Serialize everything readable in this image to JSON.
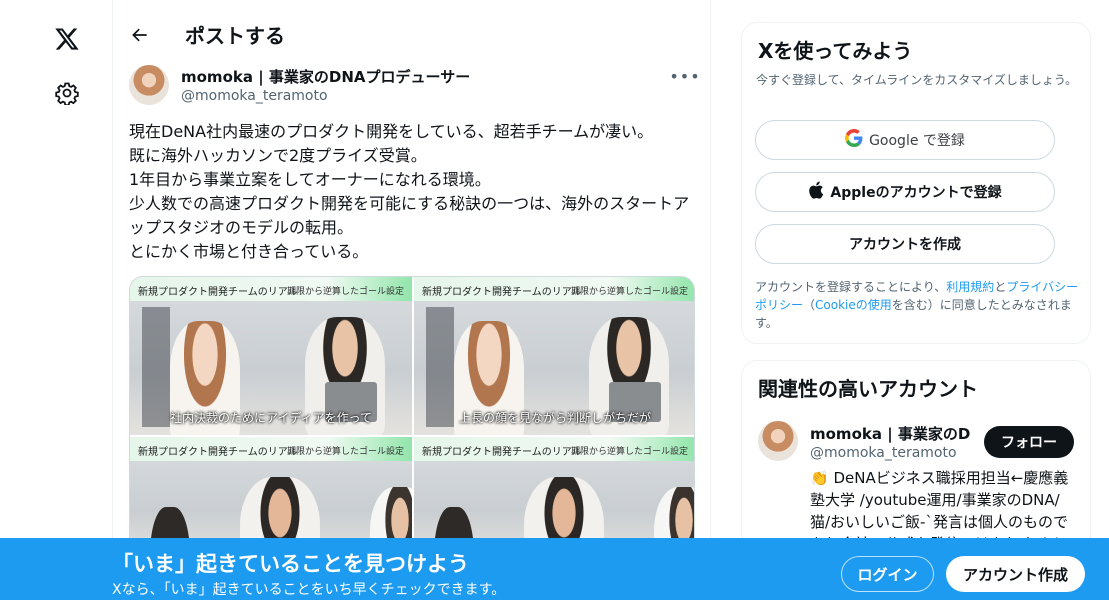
{
  "nav": {
    "logo": "x-logo-icon",
    "settings": "gear-icon"
  },
  "header": {
    "title": "ポストする"
  },
  "post": {
    "author_name": "momoka | 事業家のDNAプロデューサー",
    "author_handle": "@momoka_teramoto",
    "more": "•••",
    "lines": [
      "現在DeNA社内最速のプロダクト開発をしている、超若手チームが凄い。",
      "既に海外ハッカソンで2度プライズ受賞。",
      "1年目から事業立案をしてオーナーになれる環境。",
      "少人数での高速プロダクト開発を可能にする秘訣の一つは、海外のスタートアップスタジオのモデルの転用。",
      "とにかく市場と付き合っている。"
    ],
    "media": [
      {
        "label_left": "新規プロダクト開発チームのリアル",
        "label_right": "期限から逆算したゴール設定",
        "subtitle": "社内決裁のためにアイディアを作って"
      },
      {
        "label_left": "新規プロダクト開発チームのリアル",
        "label_right": "期限から逆算したゴール設定",
        "subtitle": "上長の顔を見ながら判断しがちだが"
      },
      {
        "label_left": "新規プロダクト開発チームのリアル",
        "label_right": "期限から逆算したゴール設定",
        "subtitle": ""
      },
      {
        "label_left": "新規プロダクト開発チームのリアル",
        "label_right": "期限から逆算したゴール設定",
        "subtitle": ""
      }
    ]
  },
  "signup": {
    "title": "Xを使ってみよう",
    "desc": "今すぐ登録して、タイムラインをカスタマイズしましょう。",
    "google_label": "Google で登録",
    "apple_label": "Appleのアカウントで登録",
    "create_label": "アカウントを作成",
    "legal_pre": "アカウントを登録することにより、",
    "legal_terms": "利用規約",
    "legal_and": "と",
    "legal_privacy": "プライバシーポリシー",
    "legal_paren_open": "（",
    "legal_cookie": "Cookieの使用",
    "legal_post": "を含む）に同意したとみなされます。"
  },
  "related": {
    "title": "関連性の高いアカウント",
    "name": "momoka | 事業家のDNA",
    "handle": "@momoka_teramoto",
    "follow_label": "フォロー",
    "bio": "👏 DeNAビジネス職採用担当←慶應義塾大学 /youtube運用/事業家のDNA/猫/おいしいご飯-`発言は個人のものであり会社の公式な発信ではありません"
  },
  "banner": {
    "title": "「いま」起きていることを見つけよう",
    "sub": "Xなら、「いま」起きていることをいち早くチェックできます。",
    "login_label": "ログイン",
    "signup_label": "アカウント作成"
  },
  "colors": {
    "accent": "#1d9bf0",
    "text": "#0f1419",
    "muted": "#536471"
  }
}
